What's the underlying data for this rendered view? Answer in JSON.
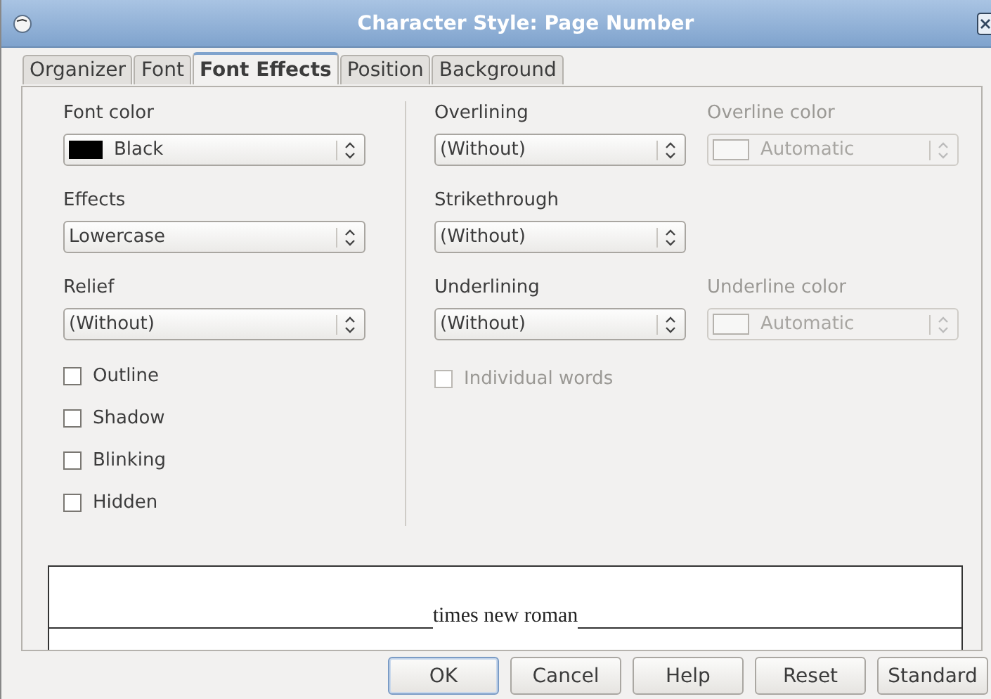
{
  "window": {
    "title": "Character Style: Page Number"
  },
  "tabs": [
    {
      "label": "Organizer",
      "selected": false
    },
    {
      "label": "Font",
      "selected": false
    },
    {
      "label": "Font Effects",
      "selected": true
    },
    {
      "label": "Position",
      "selected": false
    },
    {
      "label": "Background",
      "selected": false
    }
  ],
  "left_fields": [
    {
      "label": "Font color",
      "value": "Black",
      "color": "#000000",
      "disabled": false
    },
    {
      "label": "Effects",
      "value": "Lowercase",
      "disabled": false
    },
    {
      "label": "Relief",
      "value": "(Without)",
      "disabled": false
    }
  ],
  "checkboxes": [
    {
      "label": "Outline",
      "checked": false,
      "disabled": false
    },
    {
      "label": "Shadow",
      "checked": false,
      "disabled": false
    },
    {
      "label": "Blinking",
      "checked": false,
      "disabled": false
    },
    {
      "label": "Hidden",
      "checked": false,
      "disabled": false
    }
  ],
  "right_rows": [
    {
      "line": {
        "label": "Overlining",
        "value": "(Without)",
        "disabled": false
      },
      "color_field": {
        "label": "Overline color",
        "value": "Automatic",
        "disabled": true
      }
    },
    {
      "line": {
        "label": "Strikethrough",
        "value": "(Without)",
        "disabled": false
      }
    },
    {
      "line": {
        "label": "Underlining",
        "value": "(Without)",
        "disabled": false
      },
      "color_field": {
        "label": "Underline color",
        "value": "Automatic",
        "disabled": true
      }
    }
  ],
  "individual_words": {
    "label": "Individual words",
    "checked": false,
    "disabled": true
  },
  "preview": {
    "text": "times new roman"
  },
  "buttons": [
    {
      "label": "OK",
      "default": true
    },
    {
      "label": "Cancel",
      "default": false
    },
    {
      "label": "Help",
      "default": false
    },
    {
      "label": "Reset",
      "default": false
    },
    {
      "label": "Standard",
      "default": false
    }
  ]
}
